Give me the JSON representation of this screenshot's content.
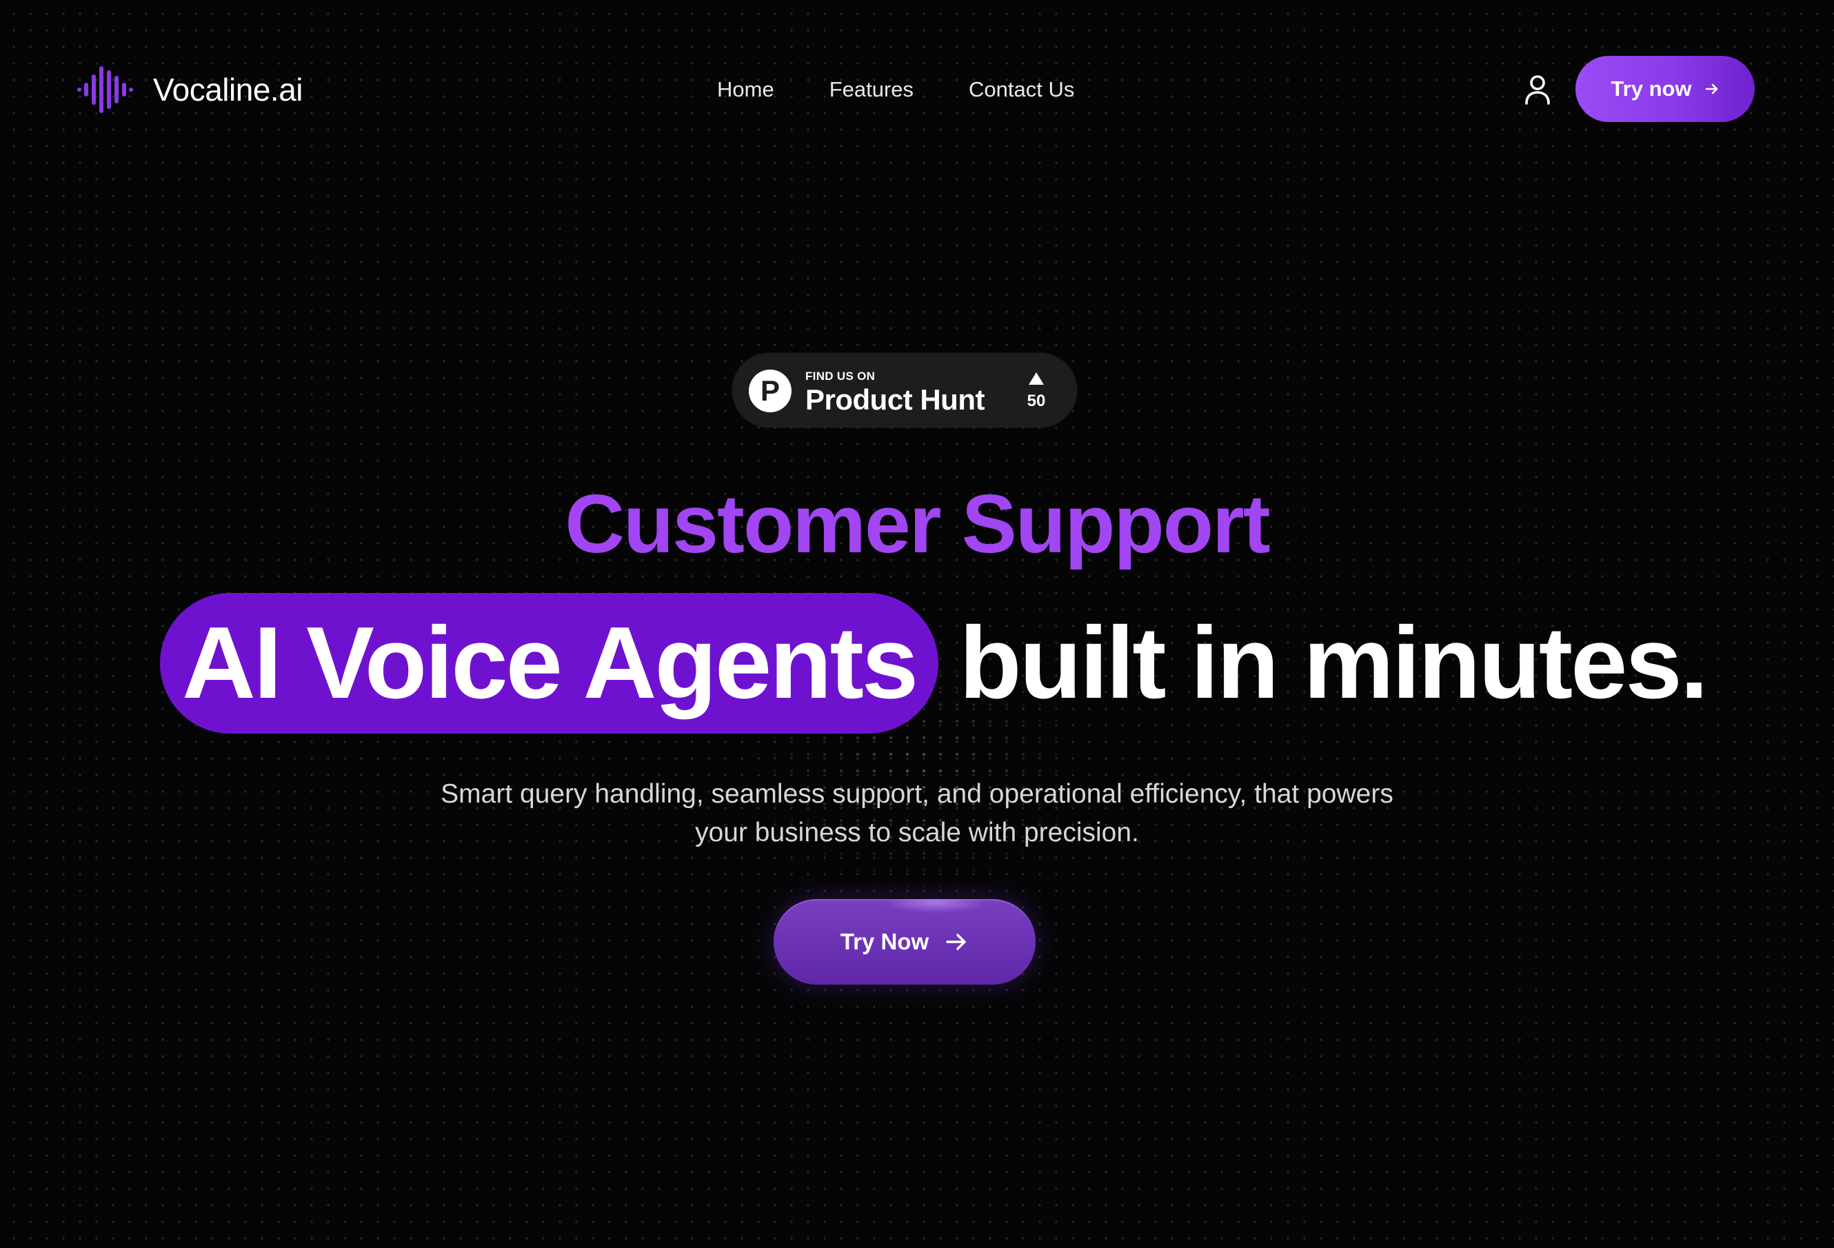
{
  "nav": {
    "brand": "Vocaline.ai",
    "links": [
      {
        "label": "Home"
      },
      {
        "label": "Features"
      },
      {
        "label": "Contact Us"
      }
    ],
    "cta_label": "Try now",
    "cta_icon": "arrow-right-icon",
    "user_icon": "user-icon"
  },
  "badge": {
    "eyebrow": "FIND US ON",
    "name": "Product Hunt",
    "logo_letter": "P",
    "upvotes": "50"
  },
  "hero": {
    "subhead": "Customer Support",
    "highlight": "AI Voice Agents",
    "headline_rest": "built in minutes.",
    "description_line1": "Smart query handling, seamless support, and operational efficiency, that powers",
    "description_line2": "your business to scale with precision.",
    "cta_label": "Try Now",
    "cta_icon": "arrow-right-icon"
  },
  "colors": {
    "background": "#050505",
    "accent": "#a146f2",
    "highlight_pill": "#6f12d0",
    "button_gradient_start": "#9b4cf5",
    "button_gradient_end": "#6f22cf"
  }
}
